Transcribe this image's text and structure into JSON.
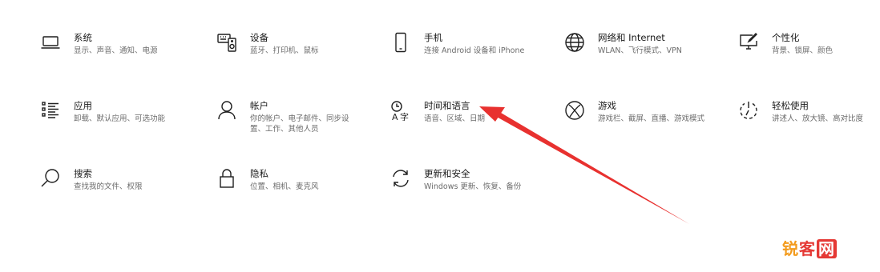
{
  "tiles": [
    {
      "id": "system",
      "title": "系统",
      "desc": "显示、声音、通知、电源"
    },
    {
      "id": "devices",
      "title": "设备",
      "desc": "蓝牙、打印机、鼠标"
    },
    {
      "id": "phone",
      "title": "手机",
      "desc": "连接 Android 设备和 iPhone"
    },
    {
      "id": "network",
      "title": "网络和 Internet",
      "desc": "WLAN、飞行模式、VPN"
    },
    {
      "id": "personalization",
      "title": "个性化",
      "desc": "背景、锁屏、颜色"
    },
    {
      "id": "apps",
      "title": "应用",
      "desc": "卸载、默认应用、可选功能"
    },
    {
      "id": "accounts",
      "title": "帐户",
      "desc": "你的帐户、电子邮件、同步设置、工作、其他人员"
    },
    {
      "id": "time_language",
      "title": "时间和语言",
      "desc": "语音、区域、日期"
    },
    {
      "id": "gaming",
      "title": "游戏",
      "desc": "游戏栏、截屏、直播、游戏模式"
    },
    {
      "id": "ease_of_access",
      "title": "轻松使用",
      "desc": "讲述人、放大镜、高对比度"
    },
    {
      "id": "search",
      "title": "搜索",
      "desc": "查找我的文件、权限"
    },
    {
      "id": "privacy",
      "title": "隐私",
      "desc": "位置、相机、麦克风"
    },
    {
      "id": "update_security",
      "title": "更新和安全",
      "desc": "Windows 更新、恢复、备份"
    }
  ],
  "watermark": {
    "part1": "锐",
    "part2": "客",
    "part3": "网"
  },
  "annotation": {
    "arrow_color": "#e8312f"
  }
}
